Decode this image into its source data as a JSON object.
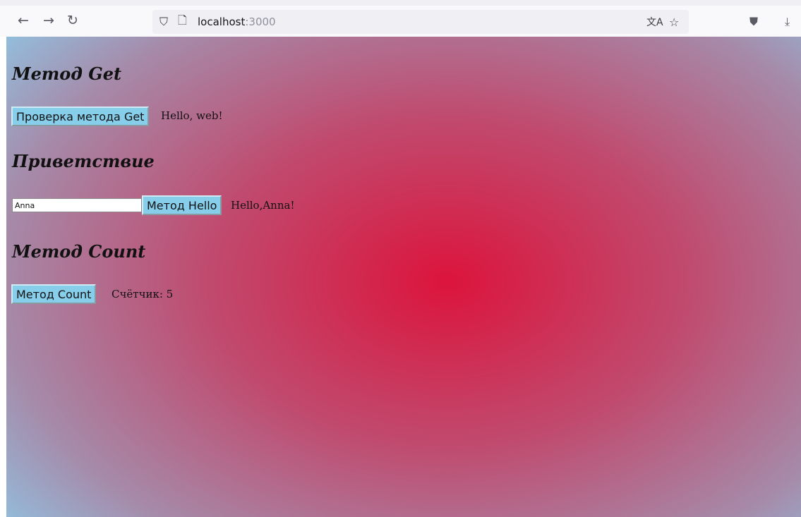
{
  "browser": {
    "url_host": "localhost",
    "url_port": ":3000"
  },
  "page": {
    "get_section": {
      "heading": "Метод Get",
      "button_label": "Проверка метода Get",
      "result": "Hello, web!"
    },
    "hello_section": {
      "heading": "Приветствие",
      "input_value": "Anna",
      "button_label": "Метод Hello",
      "result": "Hello,Anna!"
    },
    "count_section": {
      "heading": "Метод Count",
      "button_label": "Метод Count",
      "result": "Счётчик: 5"
    }
  },
  "colors": {
    "gradient_center": "#dc143c",
    "gradient_edge": "#87ceeb",
    "button_bg": "#87ceeb"
  }
}
